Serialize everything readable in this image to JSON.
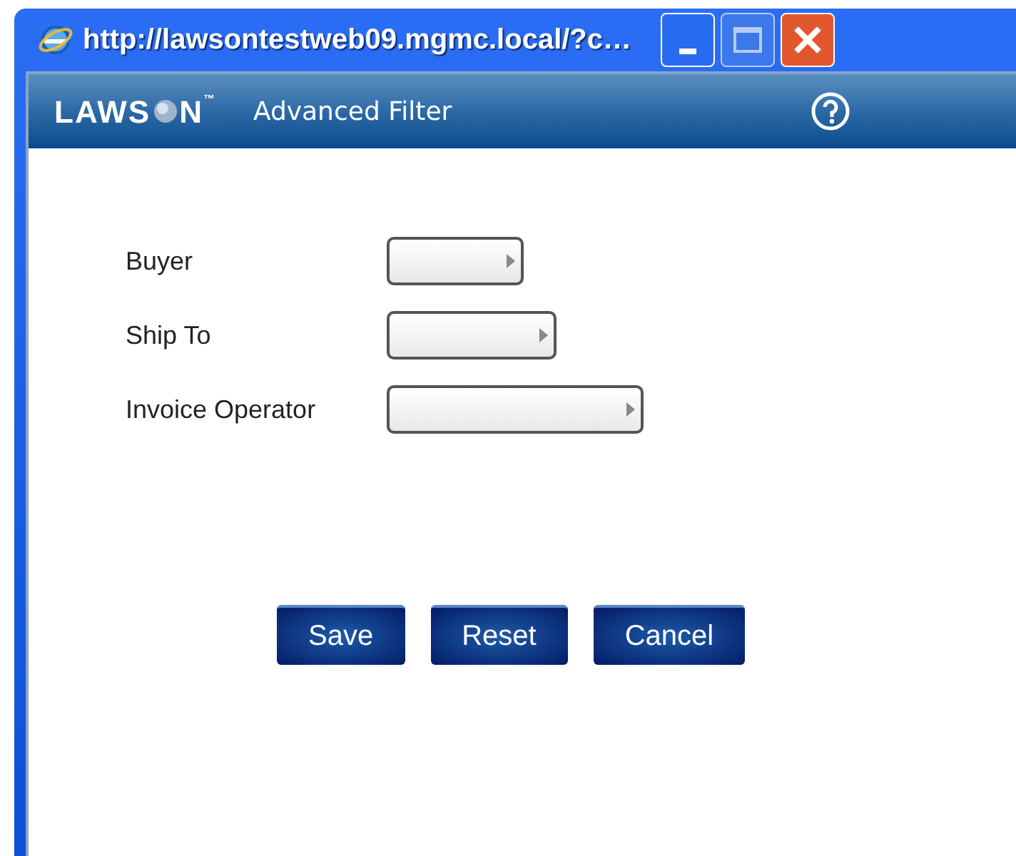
{
  "window": {
    "title": "http://lawsontestweb09.mgmc.local/?c…"
  },
  "header": {
    "logo_left": "LAWS",
    "logo_right": "N",
    "logo_mark": "™",
    "title": "Advanced Filter"
  },
  "fields": [
    {
      "label": "Buyer"
    },
    {
      "label": "Ship To"
    },
    {
      "label": "Invoice Operator"
    }
  ],
  "buttons": [
    "Save",
    "Reset",
    "Cancel"
  ]
}
